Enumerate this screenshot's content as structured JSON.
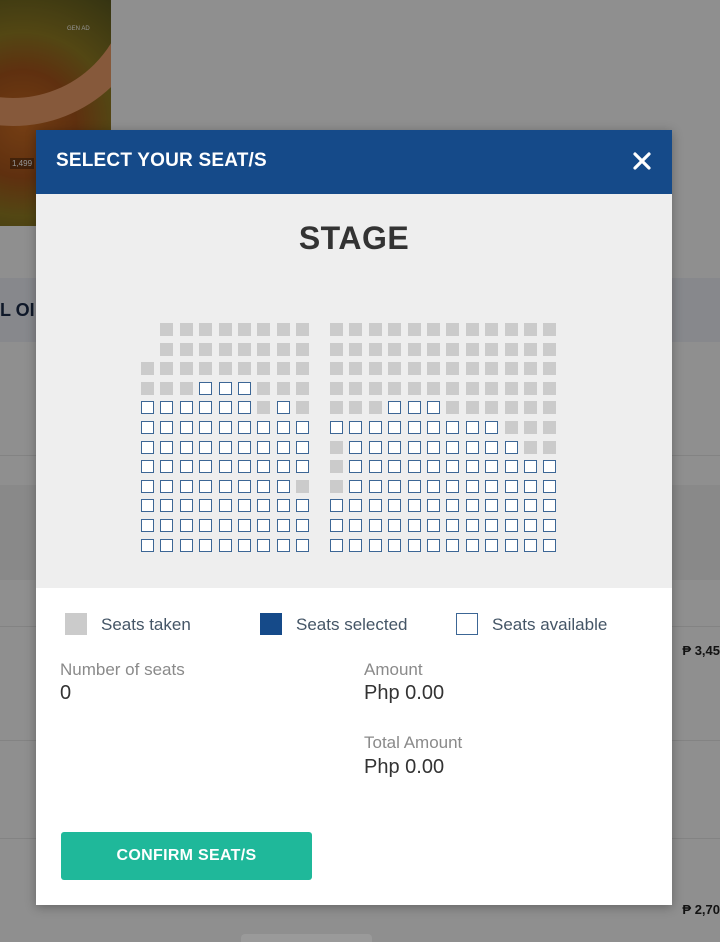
{
  "background": {
    "banner_ring_label": "GEN AD",
    "banner_count": "1,499",
    "strip_text": "L OI",
    "prices": [
      "₱ 3,45",
      "₱ 2,70"
    ]
  },
  "modal": {
    "title": "SELECT YOUR SEAT/S",
    "close_icon": "close-icon",
    "stage_label": "STAGE"
  },
  "seat_map": {
    "legend_codes": {
      "T": "taken",
      "A": "available",
      "S": "selected"
    },
    "left_section": [
      "-TTTTTTTT",
      "-TTTTTTTT",
      "TTTTTTTTT",
      "TTTAAATTT",
      "AAAAAATAT",
      "AAAAAAAAA",
      "AAAAAAAAA",
      "AAAAAAAAA",
      "AAAAAAAAT",
      "AAAAAAAAA",
      "AAAAAAAAA",
      "AAAAAAAAA"
    ],
    "right_section": [
      "TTTTTTTTTTTT",
      "TTTTTTTTTTTT",
      "TTTTTTTTTTTT",
      "TTTTTTTTTTTT",
      "TTTAAATTTTTT",
      "AAAAAAAAATTT",
      "TAAAAAAAAATT",
      "TAAAAAAAAAAA",
      "TAAAAAAAAAAA",
      "AAAAAAAAAAAA",
      "AAAAAAAAAAAA",
      "AAAAAAAAAAAA"
    ]
  },
  "legend": {
    "taken": "Seats taken",
    "selected": "Seats selected",
    "available": "Seats available"
  },
  "colors": {
    "header": "#154a89",
    "seat_taken": "#cbcbcb",
    "seat_available_border": "#3c6695",
    "seat_selected": "#154a89",
    "confirm_button": "#1fb89a"
  },
  "summary": {
    "number_of_seats_label": "Number of seats",
    "number_of_seats_value": "0",
    "amount_label": "Amount",
    "amount_value": "Php 0.00",
    "total_amount_label": "Total Amount",
    "total_amount_value": "Php 0.00"
  },
  "confirm_button_label": "CONFIRM SEAT/S"
}
